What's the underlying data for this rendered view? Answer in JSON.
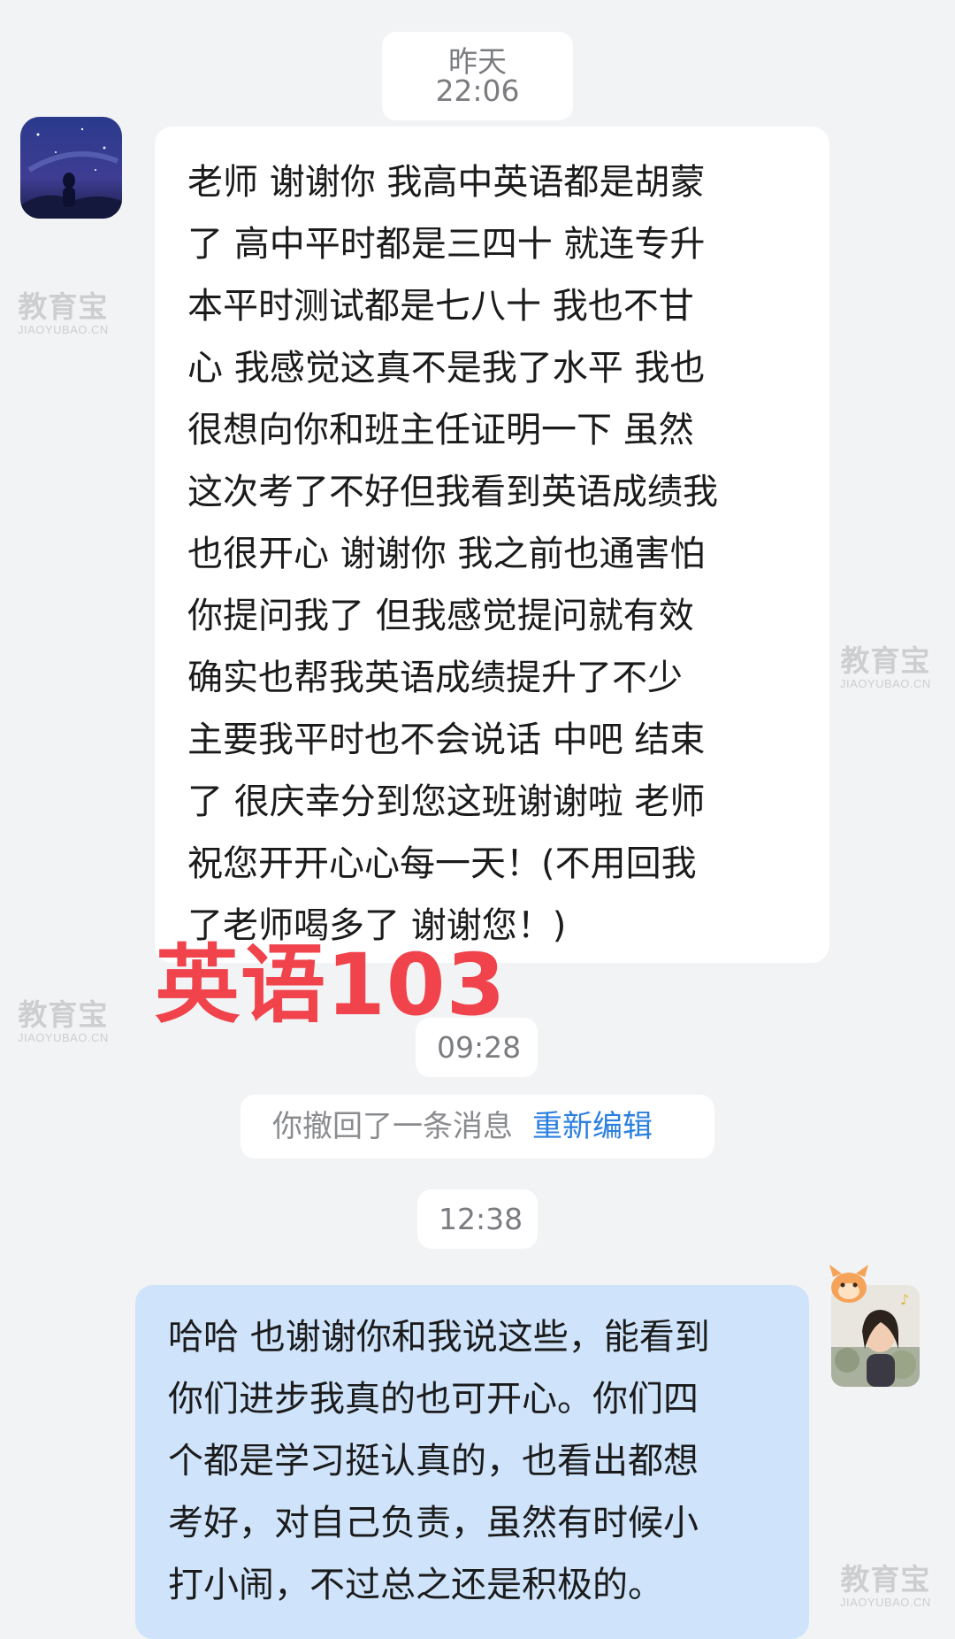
{
  "timestamps": {
    "t1": "昨天 22:06",
    "t2": "09:28",
    "t3": "12:38"
  },
  "messages": {
    "incoming": "老师 谢谢你 我高中英语都是胡蒙\n了 高中平时都是三四十 就连专升\n本平时测试都是七八十 我也不甘\n心 我感觉这真不是我了水平 我也\n很想向你和班主任证明一下 虽然\n这次考了不好但我看到英语成绩我\n也很开心 谢谢你 我之前也通害怕\n你提问我了 但我感觉提问就有效\n确实也帮我英语成绩提升了不少\n主要我平时也不会说话 中吧 结束\n了 很庆幸分到您这班谢谢啦 老师\n祝您开开心心每一天！(不用回我\n了老师喝多了 谢谢您！)",
    "outgoing": "哈哈 也谢谢你和我说这些，能看到\n你们进步我真的也可开心。你们四\n个都是学习挺认真的，也看出都想\n考好，对自己负责，虽然有时候小\n打小闹，不过总之还是积极的。"
  },
  "recall": {
    "text": "你撤回了一条消息",
    "reedit": "重新编辑"
  },
  "overlay_label": "英语103",
  "watermark": {
    "cn": "教育宝",
    "en": "JIAOYUBAO.CN"
  }
}
